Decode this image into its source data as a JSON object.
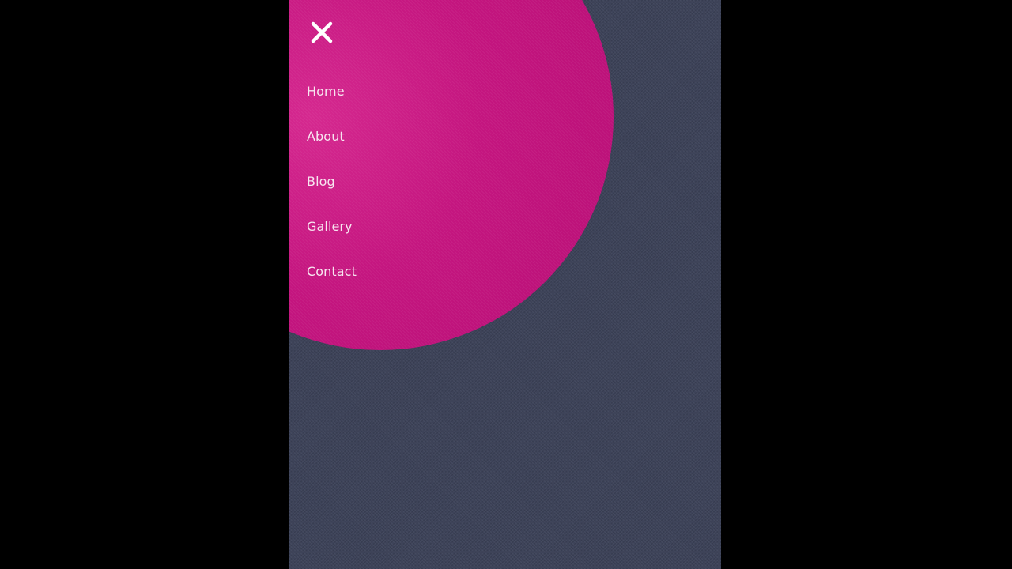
{
  "menu": {
    "close_icon": "close-icon",
    "items": [
      {
        "label": "Home"
      },
      {
        "label": "About"
      },
      {
        "label": "Blog"
      },
      {
        "label": "Gallery"
      },
      {
        "label": "Contact"
      }
    ]
  },
  "colors": {
    "page_background": "#000000",
    "content_background": "#3d4359",
    "menu_accent": "#c4157f",
    "menu_text": "#f7e6f0"
  }
}
